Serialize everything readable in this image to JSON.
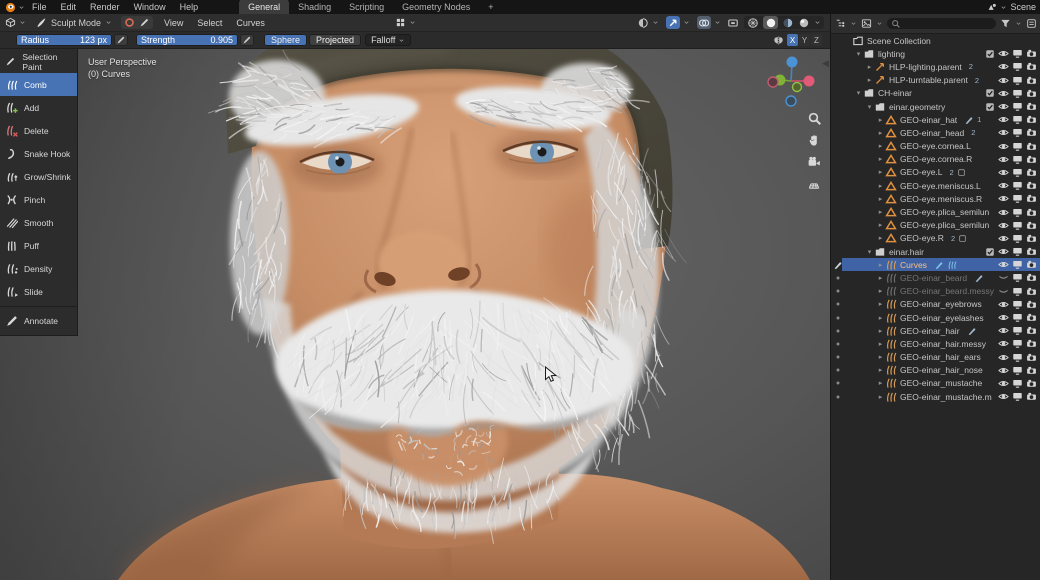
{
  "colors": {
    "accent": "#4772b3",
    "selection": "#3f63a4",
    "orange": "#e0913f",
    "icon_blue": "#7ec1e8",
    "active_name": "#ffc184"
  },
  "topbar": {
    "menus": [
      "File",
      "Edit",
      "Render",
      "Window",
      "Help"
    ],
    "tabs": [
      {
        "label": "General",
        "active": true
      },
      {
        "label": "Shading",
        "active": false
      },
      {
        "label": "Scripting",
        "active": false
      },
      {
        "label": "Geometry Nodes",
        "active": false
      },
      {
        "label": "+",
        "active": false
      }
    ],
    "scene_label": "Scene"
  },
  "viewport_header": {
    "mode_label": "Sculpt Mode",
    "menus": [
      "View",
      "Select",
      "Curves"
    ]
  },
  "tool_settings": {
    "radius_label": "Radius",
    "radius_value": "123 px",
    "strength_label": "Strength",
    "strength_value": "0.905",
    "sphere_label": "Sphere",
    "projected_label": "Projected",
    "falloff_label": "Falloff",
    "symmetry": [
      {
        "label": "X",
        "active": true
      },
      {
        "label": "Y",
        "active": false
      },
      {
        "label": "Z",
        "active": false
      }
    ]
  },
  "toolbar": {
    "tools": [
      {
        "label": "Selection Paint",
        "icon": "selection-paint",
        "active": false,
        "separated": false
      },
      {
        "label": "Comb",
        "icon": "comb",
        "active": true,
        "separated": false
      },
      {
        "label": "Add",
        "icon": "add",
        "active": false,
        "separated": false
      },
      {
        "label": "Delete",
        "icon": "delete",
        "active": false,
        "separated": false
      },
      {
        "label": "Snake Hook",
        "icon": "snake-hook",
        "active": false,
        "separated": false
      },
      {
        "label": "Grow/Shrink",
        "icon": "grow-shrink",
        "active": false,
        "separated": false
      },
      {
        "label": "Pinch",
        "icon": "pinch",
        "active": false,
        "separated": false
      },
      {
        "label": "Smooth",
        "icon": "smooth",
        "active": false,
        "separated": false
      },
      {
        "label": "Puff",
        "icon": "puff",
        "active": false,
        "separated": false
      },
      {
        "label": "Density",
        "icon": "density",
        "active": false,
        "separated": false
      },
      {
        "label": "Slide",
        "icon": "slide",
        "active": false,
        "separated": false
      },
      {
        "label": "Annotate",
        "icon": "annotate",
        "active": false,
        "separated": true
      }
    ]
  },
  "viewport": {
    "overlay_line1": "User Perspective",
    "overlay_line2": "(0) Curves"
  },
  "outliner": {
    "rows": [
      {
        "label": "Scene Collection",
        "depth": 0,
        "kind": "scene",
        "arrow": "",
        "mode": "",
        "badges": [],
        "checkbox": false,
        "eye": "",
        "screen": false,
        "camera": false,
        "grayed": false,
        "active": false
      },
      {
        "label": "lighting",
        "depth": 1,
        "kind": "collection",
        "arrow": "open",
        "mode": "",
        "badges": [],
        "checkbox": true,
        "eye": "open",
        "screen": true,
        "camera": true,
        "grayed": false,
        "active": false
      },
      {
        "label": "HLP-lighting.parent",
        "depth": 2,
        "kind": "empty",
        "arrow": "closed",
        "mode": "",
        "badges": [
          "2"
        ],
        "checkbox": false,
        "eye": "open",
        "screen": true,
        "camera": true,
        "grayed": false,
        "active": false
      },
      {
        "label": "HLP-turntable.parent",
        "depth": 2,
        "kind": "empty",
        "arrow": "closed",
        "mode": "",
        "badges": [
          "2"
        ],
        "checkbox": false,
        "eye": "open",
        "screen": true,
        "camera": true,
        "grayed": false,
        "active": false
      },
      {
        "label": "CH-einar",
        "depth": 1,
        "kind": "collection",
        "arrow": "open",
        "mode": "",
        "badges": [],
        "checkbox": true,
        "eye": "open",
        "screen": true,
        "camera": true,
        "grayed": false,
        "active": false
      },
      {
        "label": "einar.geometry",
        "depth": 2,
        "kind": "collection",
        "arrow": "open",
        "mode": "",
        "badges": [],
        "checkbox": true,
        "eye": "open",
        "screen": true,
        "camera": true,
        "grayed": false,
        "active": false
      },
      {
        "label": "GEO-einar_hat",
        "depth": 3,
        "kind": "mesh",
        "arrow": "closed",
        "mode": "",
        "badges": [
          "brush",
          "1"
        ],
        "checkbox": false,
        "eye": "open",
        "screen": true,
        "camera": true,
        "grayed": false,
        "active": false
      },
      {
        "label": "GEO-einar_head",
        "depth": 3,
        "kind": "mesh",
        "arrow": "closed",
        "mode": "",
        "badges": [
          "2"
        ],
        "checkbox": false,
        "eye": "open",
        "screen": true,
        "camera": true,
        "grayed": false,
        "active": false
      },
      {
        "label": "GEO-eye.cornea.L",
        "depth": 3,
        "kind": "mesh",
        "arrow": "closed",
        "mode": "",
        "badges": [],
        "checkbox": false,
        "eye": "open",
        "screen": true,
        "camera": true,
        "grayed": false,
        "active": false
      },
      {
        "label": "GEO-eye.cornea.R",
        "depth": 3,
        "kind": "mesh",
        "arrow": "closed",
        "mode": "",
        "badges": [],
        "checkbox": false,
        "eye": "open",
        "screen": true,
        "camera": true,
        "grayed": false,
        "active": false
      },
      {
        "label": "GEO-eye.L",
        "depth": 3,
        "kind": "mesh",
        "arrow": "closed",
        "mode": "",
        "badges": [
          "2",
          "box"
        ],
        "checkbox": false,
        "eye": "open",
        "screen": true,
        "camera": true,
        "grayed": false,
        "active": false
      },
      {
        "label": "GEO-eye.meniscus.L",
        "depth": 3,
        "kind": "mesh",
        "arrow": "closed",
        "mode": "",
        "badges": [],
        "checkbox": false,
        "eye": "open",
        "screen": true,
        "camera": true,
        "grayed": false,
        "active": false
      },
      {
        "label": "GEO-eye.meniscus.R",
        "depth": 3,
        "kind": "mesh",
        "arrow": "closed",
        "mode": "",
        "badges": [],
        "checkbox": false,
        "eye": "open",
        "screen": true,
        "camera": true,
        "grayed": false,
        "active": false
      },
      {
        "label": "GEO-eye.plica_semilun",
        "depth": 3,
        "kind": "mesh",
        "arrow": "closed",
        "mode": "",
        "badges": [],
        "checkbox": false,
        "eye": "open",
        "screen": true,
        "camera": true,
        "grayed": false,
        "active": false
      },
      {
        "label": "GEO-eye.plica_semilun",
        "depth": 3,
        "kind": "mesh",
        "arrow": "closed",
        "mode": "",
        "badges": [],
        "checkbox": false,
        "eye": "open",
        "screen": true,
        "camera": true,
        "grayed": false,
        "active": false
      },
      {
        "label": "GEO-eye.R",
        "depth": 3,
        "kind": "mesh",
        "arrow": "closed",
        "mode": "",
        "badges": [
          "2",
          "box"
        ],
        "checkbox": false,
        "eye": "open",
        "screen": true,
        "camera": true,
        "grayed": false,
        "active": false
      },
      {
        "label": "einar.hair",
        "depth": 2,
        "kind": "collection",
        "arrow": "open",
        "mode": "",
        "badges": [],
        "checkbox": true,
        "eye": "open",
        "screen": true,
        "camera": true,
        "grayed": false,
        "active": false
      },
      {
        "label": "Curves",
        "depth": 3,
        "kind": "curves",
        "arrow": "closed",
        "mode": "brush",
        "badges": [
          "brush-blue",
          "strands-blue"
        ],
        "checkbox": false,
        "eye": "open",
        "screen": true,
        "camera": true,
        "grayed": false,
        "active": true
      },
      {
        "label": "GEO-einar_beard",
        "depth": 3,
        "kind": "curves",
        "arrow": "closed",
        "mode": "dot",
        "badges": [
          "brush"
        ],
        "checkbox": false,
        "eye": "closed",
        "screen": true,
        "camera": true,
        "grayed": true,
        "active": false
      },
      {
        "label": "GEO-einar_beard.messy",
        "depth": 3,
        "kind": "curves",
        "arrow": "closed",
        "mode": "dot",
        "badges": [],
        "checkbox": false,
        "eye": "closed",
        "screen": true,
        "camera": true,
        "grayed": true,
        "active": false
      },
      {
        "label": "GEO-einar_eyebrows",
        "depth": 3,
        "kind": "curves",
        "arrow": "closed",
        "mode": "dot",
        "badges": [],
        "checkbox": false,
        "eye": "open",
        "screen": true,
        "camera": true,
        "grayed": false,
        "active": false
      },
      {
        "label": "GEO-einar_eyelashes",
        "depth": 3,
        "kind": "curves",
        "arrow": "closed",
        "mode": "dot",
        "badges": [],
        "checkbox": false,
        "eye": "open",
        "screen": true,
        "camera": true,
        "grayed": false,
        "active": false
      },
      {
        "label": "GEO-einar_hair",
        "depth": 3,
        "kind": "curves",
        "arrow": "closed",
        "mode": "dot",
        "badges": [
          "brush"
        ],
        "checkbox": false,
        "eye": "open",
        "screen": true,
        "camera": true,
        "grayed": false,
        "active": false
      },
      {
        "label": "GEO-einar_hair.messy",
        "depth": 3,
        "kind": "curves",
        "arrow": "closed",
        "mode": "dot",
        "badges": [],
        "checkbox": false,
        "eye": "open",
        "screen": true,
        "camera": true,
        "grayed": false,
        "active": false
      },
      {
        "label": "GEO-einar_hair_ears",
        "depth": 3,
        "kind": "curves",
        "arrow": "closed",
        "mode": "dot",
        "badges": [],
        "checkbox": false,
        "eye": "open",
        "screen": true,
        "camera": true,
        "grayed": false,
        "active": false
      },
      {
        "label": "GEO-einar_hair_nose",
        "depth": 3,
        "kind": "curves",
        "arrow": "closed",
        "mode": "dot",
        "badges": [],
        "checkbox": false,
        "eye": "open",
        "screen": true,
        "camera": true,
        "grayed": false,
        "active": false
      },
      {
        "label": "GEO-einar_mustache",
        "depth": 3,
        "kind": "curves",
        "arrow": "closed",
        "mode": "dot",
        "badges": [],
        "checkbox": false,
        "eye": "open",
        "screen": true,
        "camera": true,
        "grayed": false,
        "active": false
      },
      {
        "label": "GEO-einar_mustache.m",
        "depth": 3,
        "kind": "curves",
        "arrow": "closed",
        "mode": "dot",
        "badges": [],
        "checkbox": false,
        "eye": "open",
        "screen": true,
        "camera": true,
        "grayed": false,
        "active": false
      }
    ]
  }
}
